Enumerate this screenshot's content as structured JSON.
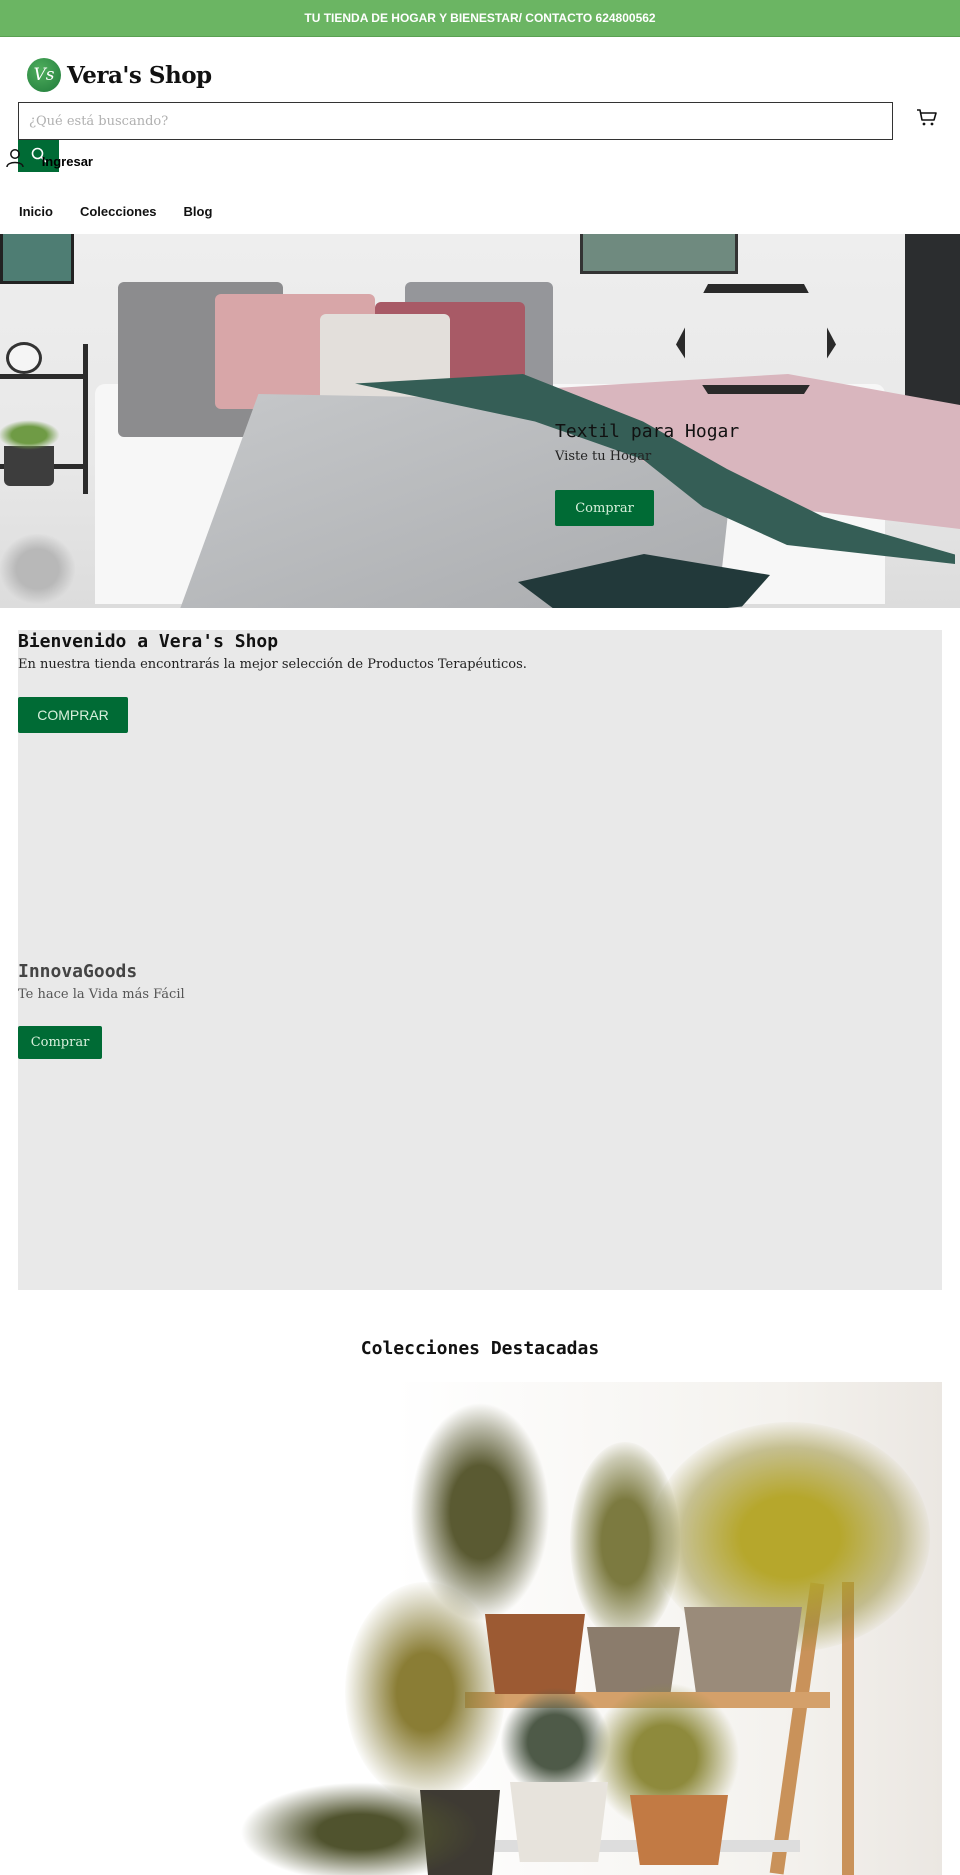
{
  "announcement": {
    "text": "TU TIENDA DE HOGAR Y BIENESTAR/ CONTACTO 624800562",
    "background_color": "#6bb563"
  },
  "header": {
    "logo_mark": "Vs",
    "logo_text": "Vera's Shop",
    "search": {
      "value": "",
      "placeholder": "¿Qué está buscando?"
    },
    "account_label": "Ingresar",
    "icons": {
      "search": "search-icon",
      "cart": "cart-icon",
      "account": "user-icon"
    }
  },
  "nav": {
    "items": [
      {
        "label": "Inicio"
      },
      {
        "label": "Colecciones"
      },
      {
        "label": "Blog"
      }
    ]
  },
  "hero": {
    "title": "Textil para Hogar",
    "subtitle": "Viste tu Hogar",
    "button_label": "Comprar"
  },
  "promo": {
    "welcome": {
      "title": "Bienvenido a Vera's Shop",
      "text": "En nuestra tienda encontrarás la mejor selección de Productos Terapéuticos.",
      "button_label": "COMPRAR"
    },
    "brand": {
      "title": "InnovaGoods",
      "text": "Te hace la Vida más Fácil",
      "button_label": "Comprar"
    }
  },
  "featured_collections": {
    "title": "Colecciones Destacadas"
  },
  "colors": {
    "brand_green": "#006b35",
    "banner_green": "#6bb563",
    "promo_background": "#e9e9e9"
  }
}
